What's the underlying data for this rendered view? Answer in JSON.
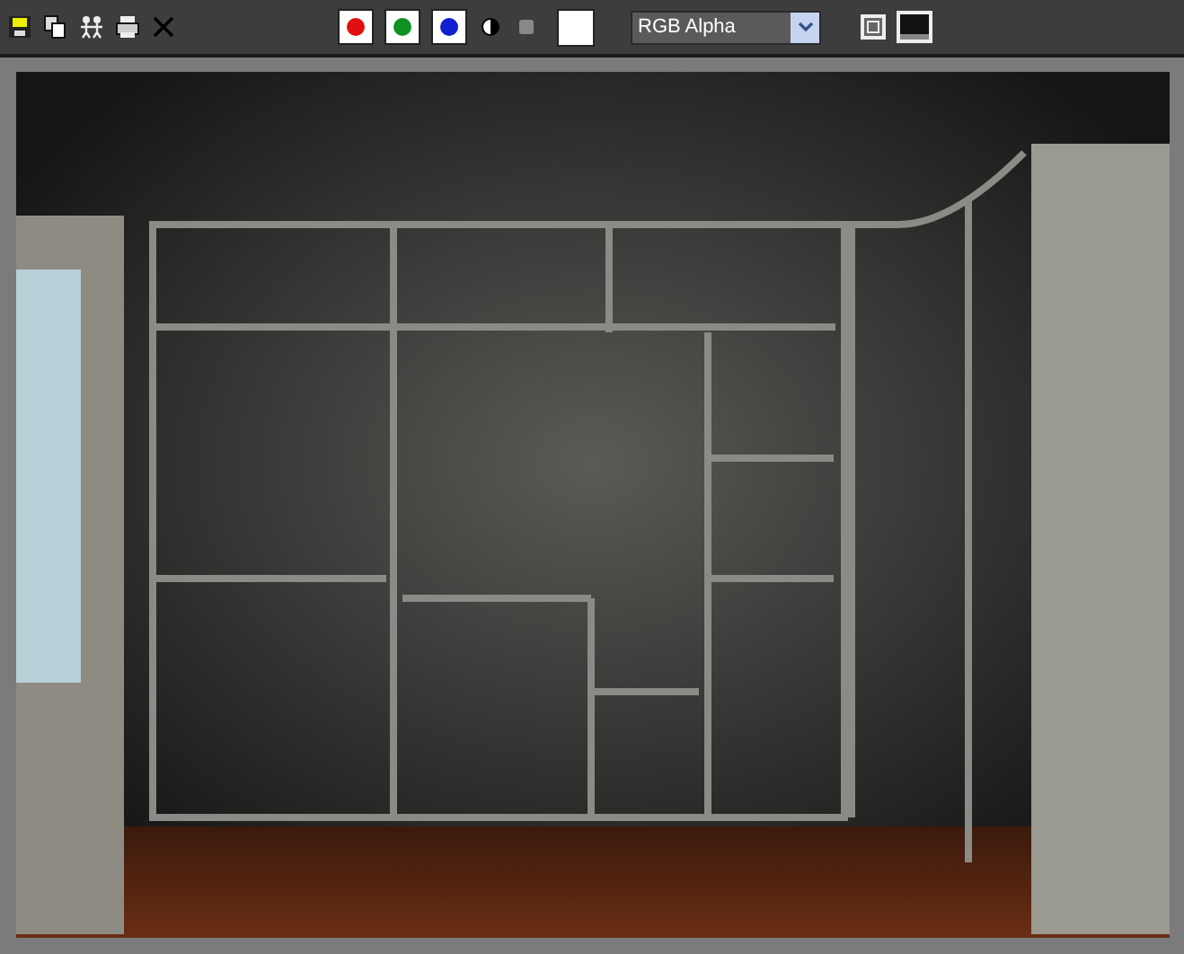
{
  "toolbar": {
    "channels": [
      {
        "kind": "red",
        "on": true
      },
      {
        "kind": "green",
        "on": true
      },
      {
        "kind": "blue",
        "on": true
      }
    ],
    "display": {
      "value": "RGB Alpha"
    }
  }
}
